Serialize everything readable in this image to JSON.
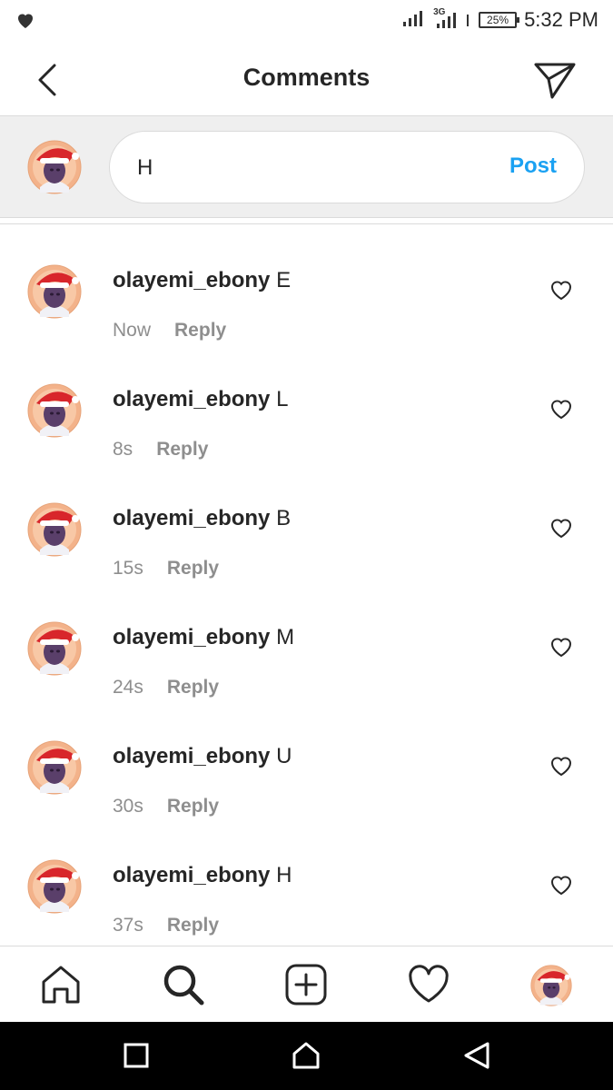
{
  "status_bar": {
    "network_label": "3G",
    "battery": "25%",
    "time": "5:32 PM",
    "left_icon": "heart-icon"
  },
  "header": {
    "title": "Comments",
    "back_icon": "chevron-left-icon",
    "send_icon": "paper-plane-icon"
  },
  "composer": {
    "value": "H",
    "post_label": "Post"
  },
  "comments": [
    {
      "username": "olayemi_ebony",
      "text": "E",
      "time": "Now",
      "reply_label": "Reply"
    },
    {
      "username": "olayemi_ebony",
      "text": "L",
      "time": "8s",
      "reply_label": "Reply"
    },
    {
      "username": "olayemi_ebony",
      "text": "B",
      "time": "15s",
      "reply_label": "Reply"
    },
    {
      "username": "olayemi_ebony",
      "text": "M",
      "time": "24s",
      "reply_label": "Reply"
    },
    {
      "username": "olayemi_ebony",
      "text": "U",
      "time": "30s",
      "reply_label": "Reply"
    },
    {
      "username": "olayemi_ebony",
      "text": "H",
      "time": "37s",
      "reply_label": "Reply"
    }
  ],
  "bottom_nav": {
    "items": [
      "home-icon",
      "search-icon",
      "add-post-icon",
      "activity-heart-icon",
      "profile-avatar"
    ]
  },
  "system_nav": {
    "items": [
      "recents-square-icon",
      "home-triangle-icon",
      "back-triangle-icon"
    ]
  },
  "colors": {
    "accent": "#1aa1f2",
    "text": "#262626",
    "muted": "#8e8e8e",
    "avatar_bg": "#f3b28a",
    "santa_red": "#d8262b"
  }
}
